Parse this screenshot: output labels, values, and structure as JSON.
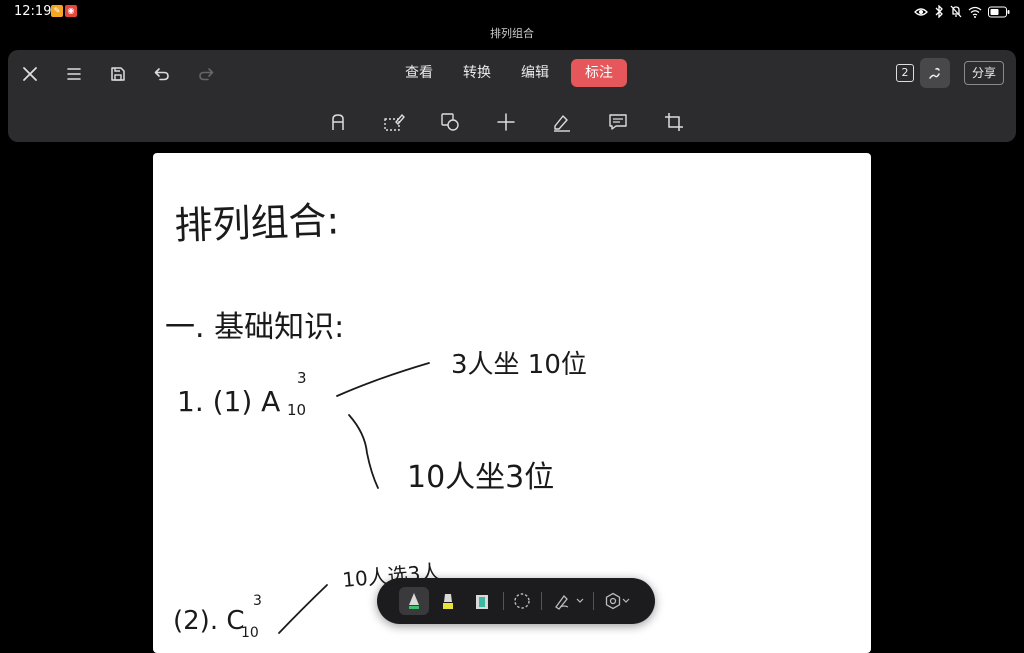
{
  "status": {
    "time": "12:19",
    "badge1_color": "#f5a623",
    "badge2_color": "#e8473c",
    "icons": [
      "eye-icon",
      "bluetooth-icon",
      "mute-icon",
      "wifi-icon",
      "battery-icon"
    ]
  },
  "document": {
    "title": "排列组合"
  },
  "toolbar": {
    "left_icons": [
      "close-icon",
      "menu-icon",
      "save-icon",
      "undo-icon",
      "redo-icon"
    ],
    "tabs": [
      {
        "label": "查看"
      },
      {
        "label": "转换"
      },
      {
        "label": "编辑"
      },
      {
        "label": "标注",
        "active": true
      }
    ],
    "accent_color": "#e5575a",
    "page_count": "2",
    "share_label": "分享",
    "tools": [
      "text-tool-icon",
      "select-area-icon",
      "shape-icon",
      "insert-icon",
      "eraser-pen-icon",
      "comment-icon",
      "crop-icon"
    ]
  },
  "handwriting": {
    "title": "排列组合:",
    "section1": "一. 基础知识:",
    "item1": "1. (1) A",
    "item1_sup": "3",
    "item1_sub": "10",
    "branch1": "3人坐 10位",
    "branch2": "10人坐3位",
    "item2": "(2). C",
    "item2_sup": "3",
    "item2_sub": "10",
    "branch3": "10人选3人"
  },
  "float_toolbar": {
    "tools": [
      "pen-icon",
      "highlighter-icon",
      "eraser-icon",
      "lasso-icon",
      "pen-style-icon",
      "settings-icon"
    ]
  }
}
